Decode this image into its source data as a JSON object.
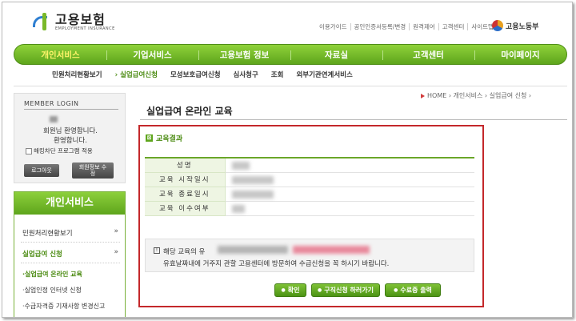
{
  "header": {
    "logo_title": "고용보험",
    "logo_sub": "EMPLOYMENT INSURANCE",
    "top_links": [
      "이용가이드",
      "공인인증서등록/변경",
      "원격제어",
      "고객센터",
      "사이트맵"
    ],
    "ministry": "고용노동부"
  },
  "main_nav": [
    {
      "label": "개인서비스",
      "active": true
    },
    {
      "label": "기업서비스",
      "active": false
    },
    {
      "label": "고용보험 정보",
      "active": false
    },
    {
      "label": "자료실",
      "active": false
    },
    {
      "label": "고객센터",
      "active": false
    },
    {
      "label": "마이페이지",
      "active": false
    }
  ],
  "sub_nav": [
    {
      "label": "민원처리현황보기",
      "active": false
    },
    {
      "label": "› 실업급여신청",
      "active": true
    },
    {
      "label": "모성보호급여신청",
      "active": false
    },
    {
      "label": "심사청구",
      "active": false
    },
    {
      "label": "조회",
      "active": false
    },
    {
      "label": "외부기관연계서비스",
      "active": false
    }
  ],
  "login": {
    "title": "MEMBER LOGIN",
    "line1": "회원님 환영합니다.",
    "line2": "환영합니다.",
    "checkbox_label": "해킹차단 프로그램 적용",
    "logout_label": "로그아웃",
    "edit_label": "회원정보 수정"
  },
  "side": {
    "title": "개인서비스",
    "item1": "민원처리현황보기",
    "item2": "실업급여 신청",
    "subs": [
      "·실업급여 온라인 교육",
      "·실업인정 인터넷 신청",
      "·수급자격증 기재사항 변경신고"
    ]
  },
  "breadcrumb": "HOME › 개인서비스 › 실업급여 신청 ›",
  "page_title": "실업급여 온라인 교육",
  "section_title": "교육결과",
  "table": {
    "rows": [
      {
        "label": "성명"
      },
      {
        "label": "교육 시작일시"
      },
      {
        "label": "교육 종료일시"
      },
      {
        "label": "교육 이수여부"
      }
    ]
  },
  "notice": {
    "line1_prefix": "해당 교육의 유",
    "line2": "유효날짜내에 거주지 관할 고용센터에 방문하여 수급신청을 꼭 하시기 바랍니다."
  },
  "buttons": {
    "confirm": "확인",
    "job_search": "구직신청 하러가기",
    "certificate": "수료증 출력"
  }
}
